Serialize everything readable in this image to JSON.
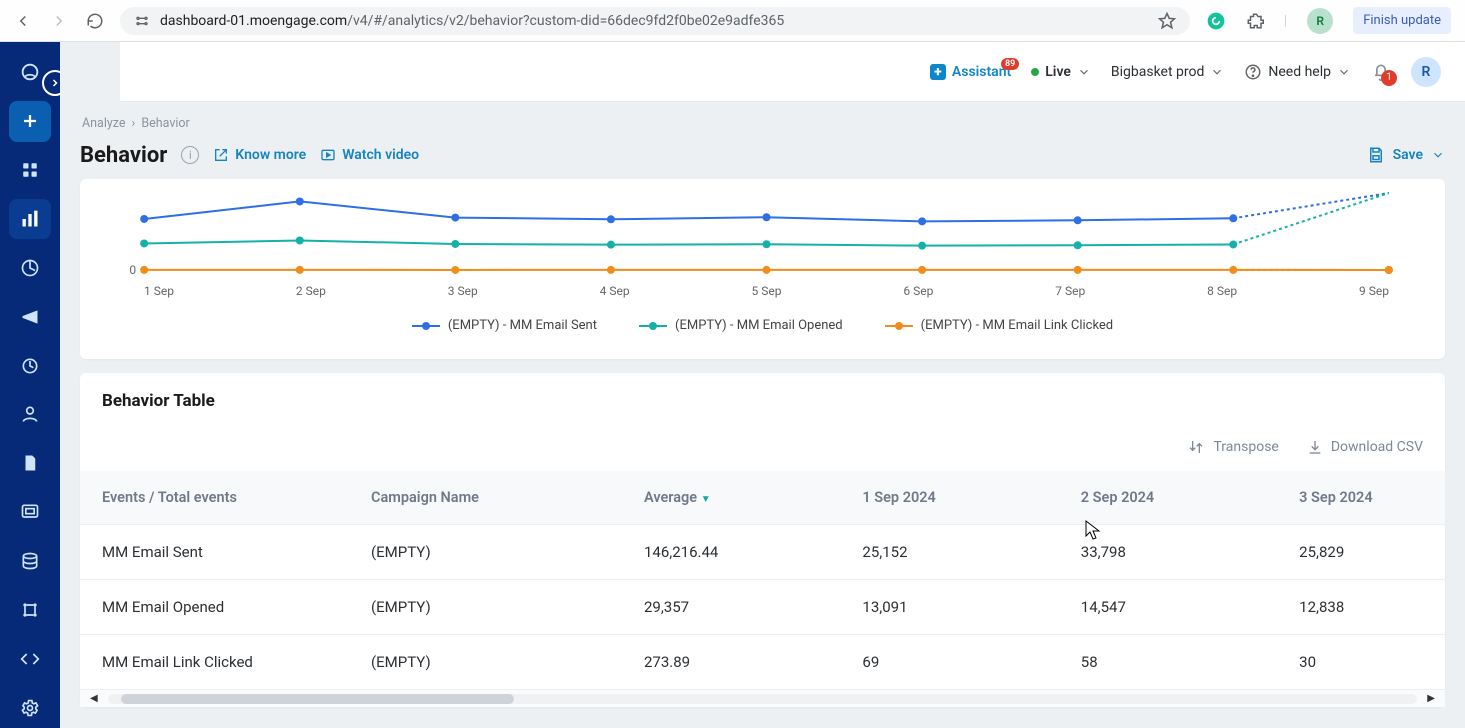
{
  "browser": {
    "url_host": "dashboard-01.moengage.com",
    "url_path": "/v4/#/analytics/v2/behavior?custom-did=66dec9fd2f0be02e9adfe365",
    "profile_initial": "R",
    "finish_label": "Finish update"
  },
  "topbar": {
    "assistant": "Assistant",
    "assistant_badge": "89",
    "status_text": "Live",
    "workspace": "Bigbasket prod",
    "help": "Need help",
    "notif_count": "1",
    "avatar_initial": "R"
  },
  "sidebar": {
    "items": [
      {
        "name": "home-icon"
      },
      {
        "name": "add-icon"
      },
      {
        "name": "dashboard-icon"
      },
      {
        "name": "analytics-icon",
        "active": true
      },
      {
        "name": "retention-icon"
      },
      {
        "name": "campaign-icon"
      },
      {
        "name": "flows-icon"
      },
      {
        "name": "user-icon"
      },
      {
        "name": "content-icon"
      },
      {
        "name": "apps-icon"
      },
      {
        "name": "data-icon"
      },
      {
        "name": "tools-icon"
      },
      {
        "name": "dev-icon"
      },
      {
        "name": "settings-icon"
      }
    ]
  },
  "breadcrumb": {
    "parent": "Analyze",
    "current": "Behavior"
  },
  "title": {
    "text": "Behavior",
    "know_more": "Know more",
    "watch_video": "Watch video",
    "save": "Save"
  },
  "chart_data": {
    "type": "line",
    "title": "",
    "ylabel": "",
    "xlabel": "",
    "categories": [
      "1 Sep",
      "2 Sep",
      "3 Sep",
      "4 Sep",
      "5 Sep",
      "6 Sep",
      "7 Sep",
      "8 Sep",
      "9 Sep"
    ],
    "series": [
      {
        "name": "(EMPTY) - MM Email Sent",
        "color": "#2e6fe6",
        "values": [
          25152,
          33798,
          25829,
          25000,
          26000,
          24000,
          24500,
          25500,
          null
        ]
      },
      {
        "name": "(EMPTY) - MM Email Opened",
        "color": "#15b0a7",
        "values": [
          13091,
          14547,
          12838,
          12500,
          12700,
          12000,
          12200,
          12600,
          null
        ]
      },
      {
        "name": "(EMPTY) - MM Email Link Clicked",
        "color": "#f28c1a",
        "values": [
          69,
          58,
          30,
          40,
          50,
          45,
          48,
          52,
          0
        ]
      }
    ],
    "y_zero_label": "0",
    "ylim": [
      0,
      35000
    ]
  },
  "table": {
    "title": "Behavior Table",
    "transpose": "Transpose",
    "download": "Download CSV",
    "headers": [
      "Events / Total events",
      "Campaign Name",
      "Average",
      "1 Sep 2024",
      "2 Sep 2024",
      "3 Sep 2024"
    ],
    "sort_col": "Average",
    "rows": [
      {
        "event": "MM Email Sent",
        "campaign": "(EMPTY)",
        "avg": "146,216.44",
        "d1": "25,152",
        "d2": "33,798",
        "d3": "25,829"
      },
      {
        "event": "MM Email Opened",
        "campaign": "(EMPTY)",
        "avg": "29,357",
        "d1": "13,091",
        "d2": "14,547",
        "d3": "12,838"
      },
      {
        "event": "MM Email Link Clicked",
        "campaign": "(EMPTY)",
        "avg": "273.89",
        "d1": "69",
        "d2": "58",
        "d3": "30"
      }
    ]
  }
}
